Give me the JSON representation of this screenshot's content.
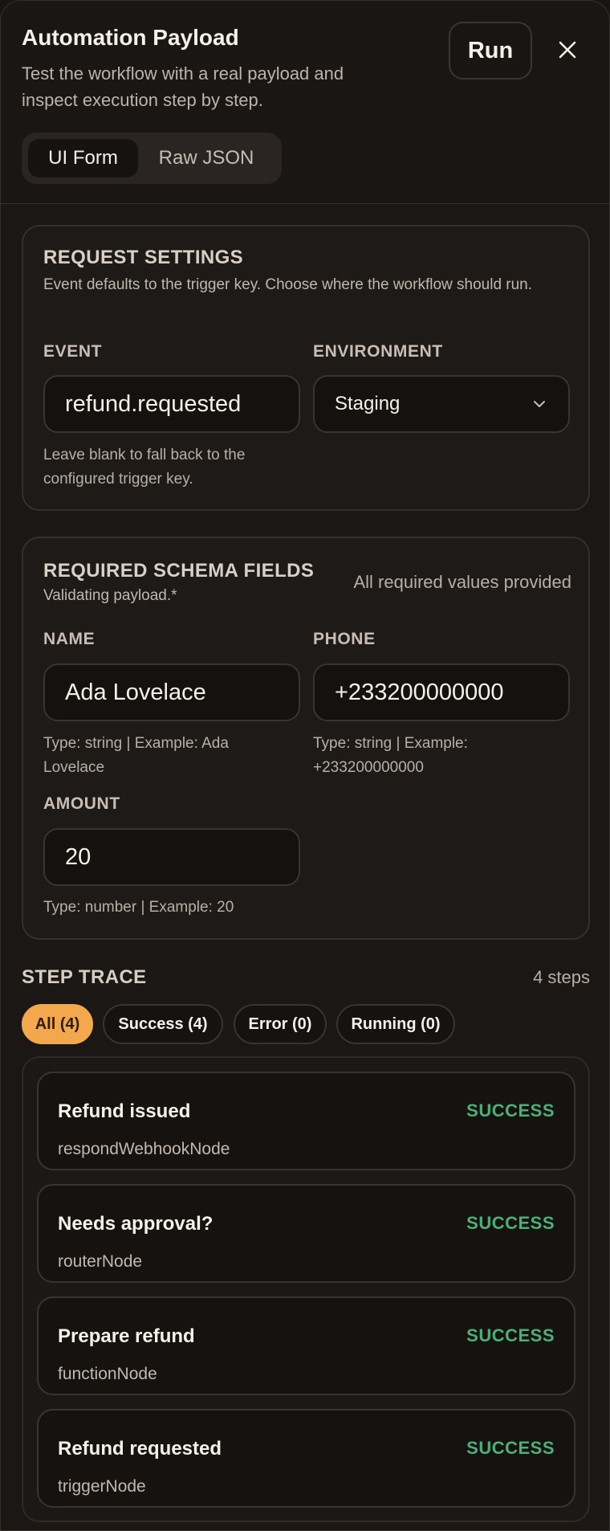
{
  "header": {
    "title": "Automation Payload",
    "subtitle": "Test the workflow with a real payload and inspect execution step by step.",
    "run_label": "Run",
    "close_icon": "close-icon",
    "tabs": [
      {
        "label": "UI Form",
        "active": true
      },
      {
        "label": "Raw JSON",
        "active": false
      }
    ]
  },
  "request_settings": {
    "title": "REQUEST SETTINGS",
    "description": "Event defaults to the trigger key. Choose where the workflow should run.",
    "event_label": "EVENT",
    "event_value": "refund.requested",
    "event_hint": "Leave blank to fall back to the configured trigger key.",
    "environment_label": "ENVIRONMENT",
    "environment_value": "Staging",
    "environment_icon": "chevron-down-icon"
  },
  "schema_fields": {
    "title": "REQUIRED SCHEMA FIELDS",
    "subtitle": "Validating payload.*",
    "status": "All required values provided",
    "fields": [
      {
        "label": "NAME",
        "value": "Ada Lovelace",
        "hint": "Type: string | Example: Ada Lovelace"
      },
      {
        "label": "PHONE",
        "value": "+233200000000",
        "hint": "Type: string | Example: +233200000000"
      },
      {
        "label": "AMOUNT",
        "value": "20",
        "hint": "Type: number | Example: 20"
      }
    ]
  },
  "trace": {
    "title": "STEP TRACE",
    "count": "4 steps",
    "filters": [
      {
        "label": "All (4)",
        "active": true
      },
      {
        "label": "Success (4)",
        "active": false
      },
      {
        "label": "Error (0)",
        "active": false
      },
      {
        "label": "Running (0)",
        "active": false
      }
    ],
    "steps": [
      {
        "name": "Refund issued",
        "node": "respondWebhookNode",
        "status": "SUCCESS"
      },
      {
        "name": "Needs approval?",
        "node": "routerNode",
        "status": "SUCCESS"
      },
      {
        "name": "Prepare refund",
        "node": "functionNode",
        "status": "SUCCESS"
      },
      {
        "name": "Refund requested",
        "node": "triggerNode",
        "status": "SUCCESS"
      }
    ],
    "success_color": "#4caf78"
  },
  "colors": {
    "accent": "#f3a84d",
    "background": "#1b1715"
  }
}
